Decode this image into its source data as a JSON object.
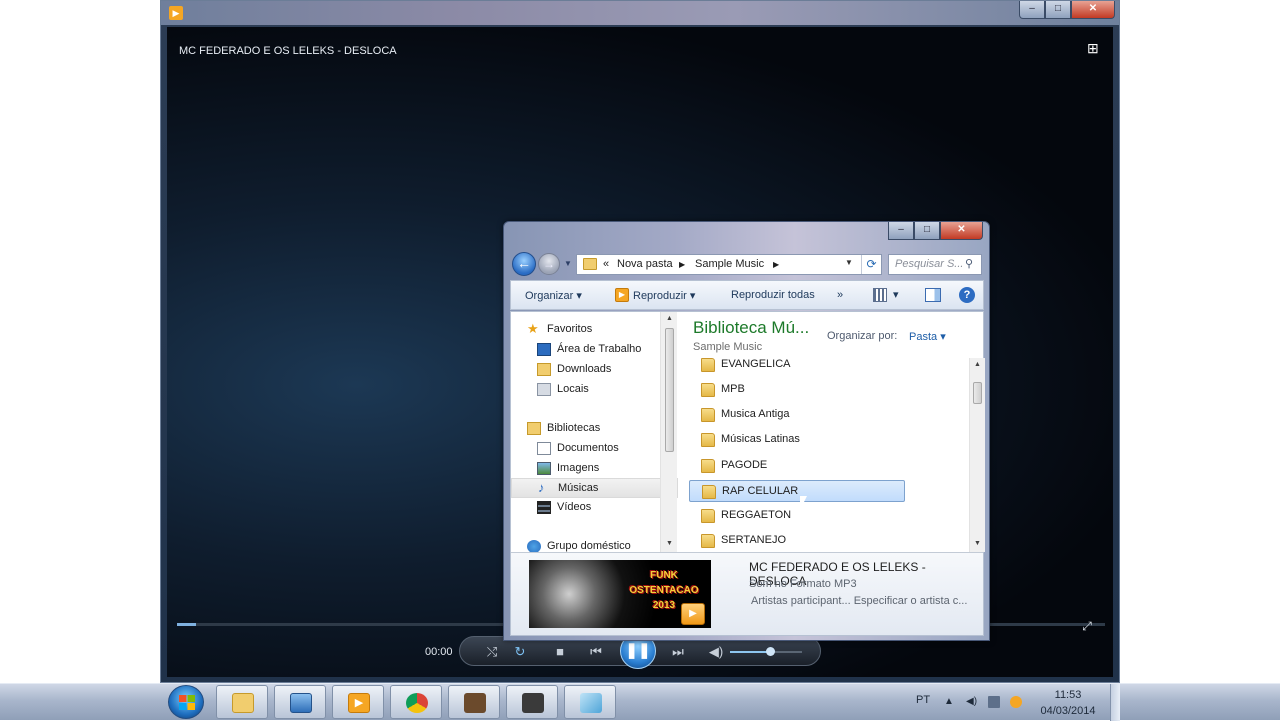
{
  "player": {
    "now_playing": "MC FEDERADO E OS LELEKS - DESLOCA",
    "elapsed_time": "00:00",
    "progress_fraction": 0.02,
    "volume_fraction": 0.55,
    "play_state": "playing",
    "icons": {
      "app": "media-player-icon",
      "switch_view": "switch-to-library-icon",
      "shuffle": "shuffle-icon",
      "repeat": "repeat-icon",
      "stop": "stop-icon",
      "previous": "previous-icon",
      "pause": "pause-icon",
      "next": "next-icon",
      "mute": "speaker-icon",
      "fullscreen": "fullscreen-icon"
    }
  },
  "explorer": {
    "breadcrumb": {
      "prefix": "«",
      "items": [
        "Nova pasta",
        "Sample Music"
      ]
    },
    "search_placeholder": "Pesquisar S...",
    "toolbar": {
      "organize": "Organizar",
      "play": "Reproduzir",
      "play_all": "Reproduzir todas",
      "more": "»"
    },
    "nav": {
      "favorites": "Favoritos",
      "favorites_items": [
        "Área de Trabalho",
        "Downloads",
        "Locais"
      ],
      "libraries": "Bibliotecas",
      "libraries_items": [
        "Documentos",
        "Imagens",
        "Músicas",
        "Vídeos"
      ],
      "selected": "Músicas",
      "homegroup": "Grupo doméstico"
    },
    "library_title": "Biblioteca Mú...",
    "library_subtitle": "Sample Music",
    "sort_label": "Organizar por:",
    "sort_value": "Pasta",
    "folders": [
      "EVANGELICA",
      "MPB",
      "Musica Antiga",
      "Músicas Latinas",
      "PAGODE",
      "RAP CELULAR",
      "REGGAETON",
      "SERTANEJO"
    ],
    "selected_folder": "RAP CELULAR",
    "details": {
      "title": "MC FEDERADO E OS LELEKS - DESLOCA",
      "type": "Som no Formato MP3",
      "artist_line": "Artistas participant...   Especificar o artista c...",
      "cover_text": "FUNK OSTENTACAO 2013"
    }
  },
  "taskbar": {
    "language": "PT",
    "time": "11:53",
    "date": "04/03/2014",
    "apps": [
      "explorer-folder-icon",
      "remote-desktop-icon",
      "media-player-icon",
      "chrome-icon",
      "game-icon",
      "game-icon-2",
      "note-icon"
    ]
  },
  "colors": {
    "library_title": "#1d7a2a",
    "selection": "#c1dcfc",
    "close_button": "#c23a24",
    "player_accent": "#2b7fd1"
  }
}
